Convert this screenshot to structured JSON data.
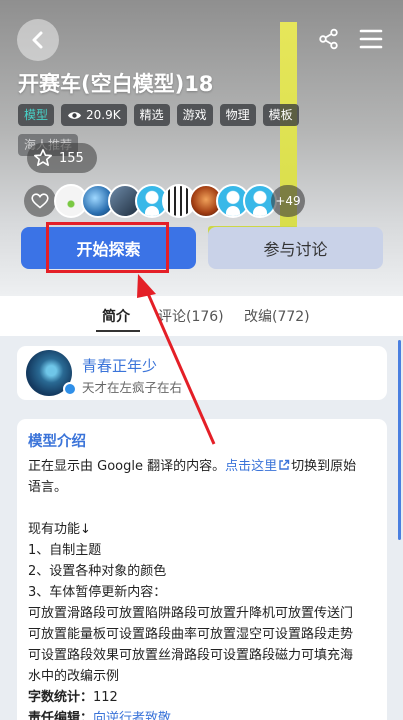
{
  "header": {
    "title": "开赛车(空白模型)18",
    "tags": [
      {
        "label": "模型",
        "accent": true
      },
      {
        "label": "20.9K",
        "icon": "eye-icon"
      },
      {
        "label": "精选"
      },
      {
        "label": "游戏"
      },
      {
        "label": "物理"
      },
      {
        "label": "模板"
      }
    ],
    "tag_second_row": "海人推荐",
    "star_count": "155",
    "more_count": "+49"
  },
  "actions": {
    "start_label": "开始探索",
    "discuss_label": "参与讨论"
  },
  "tabs": [
    {
      "label": "简介",
      "active": true
    },
    {
      "label": "评论(176)",
      "active": false
    },
    {
      "label": "改编(772)",
      "active": false
    }
  ],
  "author": {
    "name": "青春正年少",
    "signature": "天才在左疯子在右"
  },
  "description": {
    "heading": "模型介绍",
    "translate_prefix": "正在显示由 Google 翻译的内容。",
    "translate_link": "点击这里",
    "translate_suffix": "切换到原始",
    "translate_suffix2": "语言。",
    "features_title": "现有功能↓",
    "features": [
      "1、自制主题",
      "2、设置各种对象的颜色",
      "3、车体暂停更新内容："
    ],
    "updates": [
      "可放置滑路段可放置陷阱路段可放置升降机可放置传送门",
      "可放置能量板可设置路段曲率可放置湿空可设置路段走势",
      "可设置路段效果可放置丝滑路段可设置路段磁力可填充海",
      "水中的改编示例"
    ],
    "word_count_label": "字数统计：",
    "word_count": "112",
    "editor_label": "责任编辑：",
    "editor_value": "向逆行者致敬"
  },
  "colors": {
    "accent_blue": "#3b73e6",
    "link_blue": "#3b74d9",
    "annotation_red": "#e41f27",
    "tag_teal": "#48d3c9"
  }
}
